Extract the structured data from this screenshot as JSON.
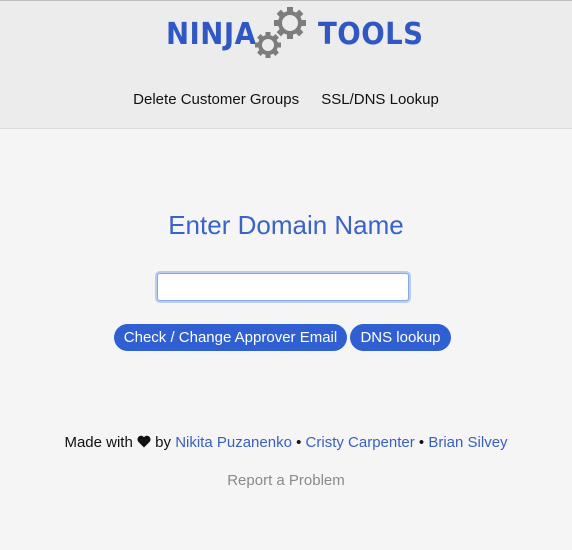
{
  "logo": {
    "left_word": "NINJA",
    "right_word": "TOOLS"
  },
  "nav": {
    "items": [
      {
        "label": "Delete Customer Groups"
      },
      {
        "label": "SSL/DNS Lookup"
      }
    ]
  },
  "main": {
    "title": "Enter Domain Name",
    "domain_input": {
      "value": "",
      "placeholder": ""
    },
    "buttons": {
      "approver_label": "Check / Change Approver Email",
      "dns_label": "DNS lookup"
    }
  },
  "footer": {
    "made_with": "Made with",
    "by": "by",
    "authors": [
      {
        "name": "Nikita Puzanenko"
      },
      {
        "name": "Cristy Carpenter"
      },
      {
        "name": "Brian Silvey"
      }
    ],
    "separator": "•",
    "report_label": "Report a Problem"
  },
  "colors": {
    "brand": "#3057c4",
    "button": "#2f5fd0",
    "link": "#3a5fc0"
  },
  "icons": {
    "gears": "gears-icon",
    "heart": "heart-icon"
  }
}
